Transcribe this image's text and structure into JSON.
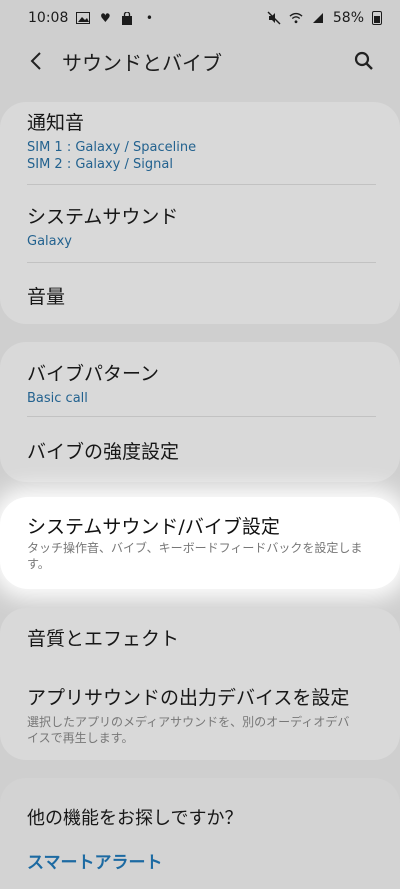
{
  "status_bar": {
    "time": "10:08",
    "battery": "58%",
    "icons": [
      "gallery-icon",
      "heart-icon",
      "shopping-bag-icon",
      "dot-icon",
      "mute-icon",
      "wifi-icon",
      "signal-icon",
      "battery-icon"
    ]
  },
  "header": {
    "title": "サウンドとバイブ"
  },
  "sound_card": {
    "notification_title": "通知音",
    "notification_sim1": "SIM 1 : Galaxy / Spaceline",
    "notification_sim2": "SIM 2 : Galaxy / Signal",
    "system_sound_title": "システムサウンド",
    "system_sound_value": "Galaxy",
    "volume_title": "音量"
  },
  "vibration_card": {
    "pattern_title": "バイブパターン",
    "pattern_value": "Basic call",
    "intensity_title": "バイブの強度設定"
  },
  "system_sound_vibe": {
    "title": "システムサウンド/バイブ設定",
    "description": "タッチ操作音、バイブ、キーボードフィードバックを設定します。"
  },
  "quality_card": {
    "quality_title": "音質とエフェクト",
    "app_output_title": "アプリサウンドの出力デバイスを設定",
    "app_output_desc": "選択したアプリのメディアサウンドを、別のオーディオデバイスで再生します。"
  },
  "more_card": {
    "question": "他の機能をお探しですか？",
    "link1": "スマートアラート"
  },
  "colors": {
    "accent": "#1c6aa2",
    "background_dim": "#cfcfcf",
    "card": "#d9d9d9"
  }
}
